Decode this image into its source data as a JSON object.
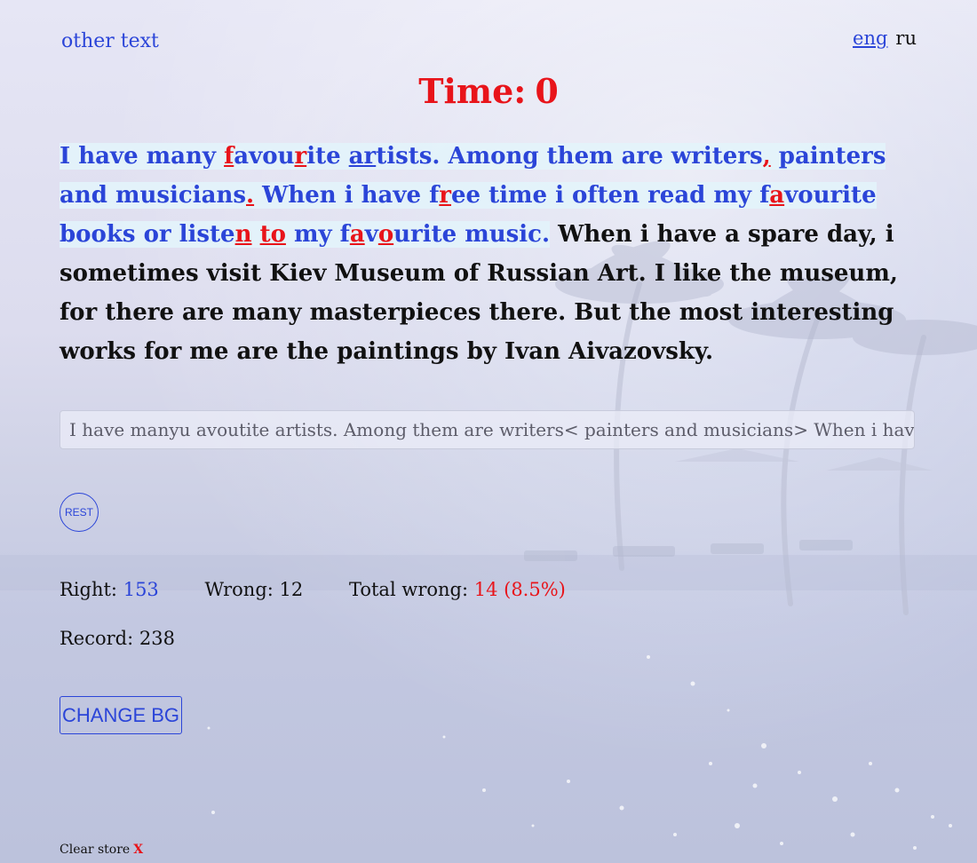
{
  "nav": {
    "other_text_link": "other text",
    "lang_eng": "eng",
    "lang_ru": "ru"
  },
  "timer": {
    "label": "Time:",
    "value": "0"
  },
  "passage": {
    "typed_segments": [
      {
        "text": "I have many ",
        "error": false
      },
      {
        "text": "f",
        "error": true
      },
      {
        "text": "avou",
        "error": false
      },
      {
        "text": "r",
        "error": true
      },
      {
        "text": "ite ",
        "error": false
      },
      {
        "text": "ar",
        "error": false,
        "underline": true
      },
      {
        "text": "tists. Among them are writers",
        "error": false
      },
      {
        "text": ",",
        "error": true
      },
      {
        "text": " painters and musicians",
        "error": false
      },
      {
        "text": ".",
        "error": true
      },
      {
        "text": " When i have f",
        "error": false
      },
      {
        "text": "r",
        "error": true
      },
      {
        "text": "ee time i often read my f",
        "error": false
      },
      {
        "text": "a",
        "error": true
      },
      {
        "text": "vourite books or liste",
        "error": false
      },
      {
        "text": "n",
        "error": true
      },
      {
        "text": " ",
        "error": false
      },
      {
        "text": "to",
        "error": true
      },
      {
        "text": " my f",
        "error": false
      },
      {
        "text": "a",
        "error": true
      },
      {
        "text": "v",
        "error": false
      },
      {
        "text": "o",
        "error": true
      },
      {
        "text": "urite music.",
        "error": false
      }
    ],
    "remaining": " When i have a spare day, i sometimes visit Kiev Museum of Russian Art. I like the museum, for there are many masterpieces there. But the most interesting works for me are the paintings by Ivan Aivazovsky."
  },
  "typing_input": {
    "value": "I have manyu avoutite artists. Among them are writers< painters and musicians> When i have"
  },
  "controls": {
    "restart_label": "REST",
    "change_bg_label": "CHANGE BG"
  },
  "stats": {
    "right_label": "Right:",
    "right_value": "153",
    "wrong_label": "Wrong:",
    "wrong_value": "12",
    "total_wrong_label": "Total wrong:",
    "total_wrong_value": "14 (8.5%)",
    "record_label": "Record:",
    "record_value": "238"
  },
  "footer": {
    "clear_store_label": "Clear store",
    "clear_store_x": "X"
  },
  "colors": {
    "accent_blue": "#2b45d8",
    "error_red": "#e8141a",
    "typed_bg": "#e2f4fa"
  },
  "icons": {
    "clear_store_icon": "x-icon"
  }
}
